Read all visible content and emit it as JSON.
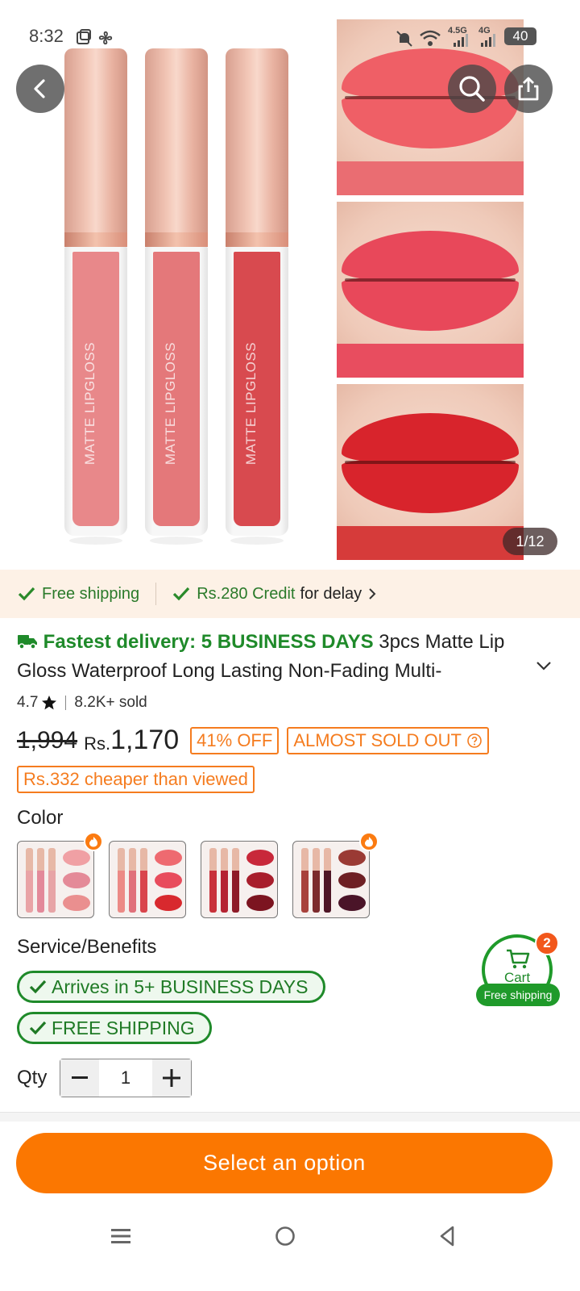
{
  "status_bar": {
    "time": "8:32",
    "net1": "4.5G",
    "net2": "4G",
    "battery": "40"
  },
  "gallery": {
    "tube_text": "MATTE LIPGLOSS",
    "counter": "1/12",
    "tubes": [
      {
        "fill": "#e8888a"
      },
      {
        "fill": "#e4787a"
      },
      {
        "fill": "#d84a4f"
      }
    ],
    "lips": [
      {
        "color": "#ef5f66",
        "swatch": "#ea6d72"
      },
      {
        "color": "#e8485a",
        "swatch": "#e84d5f"
      },
      {
        "color": "#d8242c",
        "swatch": "#d63b3a"
      }
    ]
  },
  "benefits": {
    "free_shipping": "Free shipping",
    "credit": "Rs.280 Credit",
    "credit_suffix": "for delay"
  },
  "product": {
    "fastest_delivery": "Fastest delivery: 5 BUSINESS DAYS",
    "title": "3pcs Matte Lip Gloss Waterproof Long Lasting Non-Fading Multi-",
    "rating": "4.7",
    "sold": "8.2K+ sold",
    "old_price": "1,994",
    "currency": "Rs.",
    "price": "1,170",
    "discount": "41% OFF",
    "stock": "ALMOST SOLD OUT",
    "cheaper": "Rs.332 cheaper than viewed"
  },
  "color": {
    "label": "Color",
    "options": [
      {
        "tubes": [
          "#e9a3a6",
          "#e3899a",
          "#e7a4a6"
        ],
        "lips": [
          "#f0a0a4",
          "#e48a98",
          "#ea8f8f"
        ],
        "hot": true
      },
      {
        "tubes": [
          "#ec8a86",
          "#e0707a",
          "#d9454c"
        ],
        "lips": [
          "#ee6a70",
          "#e84c5c",
          "#d8292e"
        ],
        "hot": false
      },
      {
        "tubes": [
          "#c8313a",
          "#b52332",
          "#8e1b28"
        ],
        "lips": [
          "#c8283a",
          "#a81e2c",
          "#7c1420"
        ],
        "hot": false
      },
      {
        "tubes": [
          "#a8423c",
          "#7c2a2c",
          "#4e1626"
        ],
        "lips": [
          "#9a3a34",
          "#6e2024",
          "#4a1428"
        ],
        "hot": true
      }
    ]
  },
  "service": {
    "label": "Service/Benefits",
    "arrives": "Arrives in 5+ BUSINESS DAYS",
    "free_shipping": "FREE SHIPPING"
  },
  "cart": {
    "label": "Cart",
    "count": "2",
    "free_shipping": "Free shipping"
  },
  "quantity": {
    "label": "Qty",
    "value": "1"
  },
  "cta": {
    "label": "Select an option"
  },
  "colors": {
    "accent_orange": "#fb7701",
    "green": "#1f8a2a",
    "strip_bg": "#fdf1e6"
  }
}
